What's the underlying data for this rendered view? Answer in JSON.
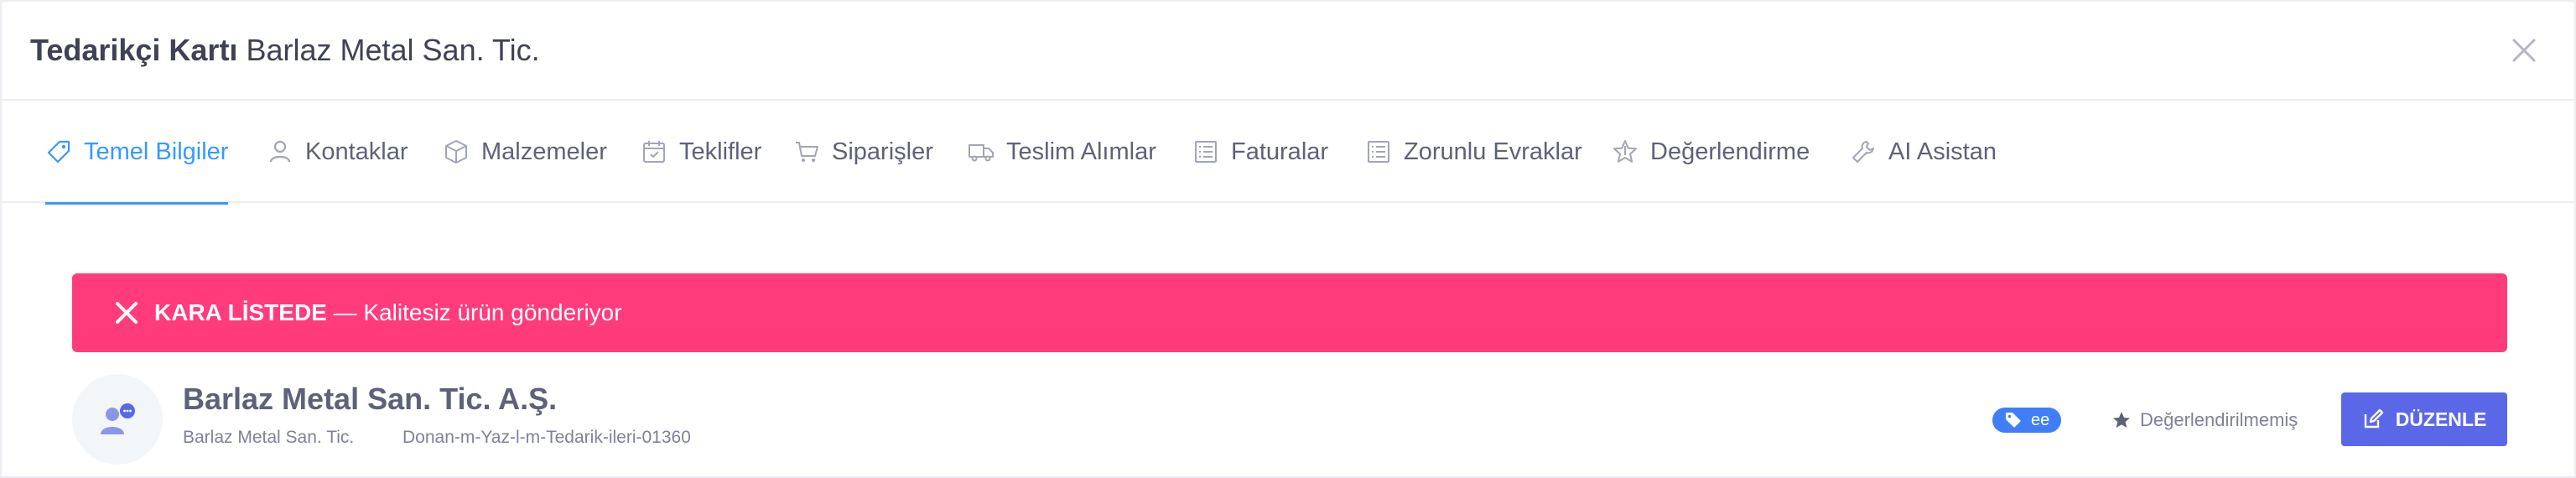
{
  "header": {
    "title_bold": "Tedarikçi Kartı",
    "title_rest": "Barlaz Metal San. Tic.",
    "close_icon": "close-icon"
  },
  "tabs": [
    {
      "label": "Temel Bilgiler",
      "icon": "tag-icon",
      "active": true
    },
    {
      "label": "Kontaklar",
      "icon": "user-icon",
      "active": false
    },
    {
      "label": "Malzemeler",
      "icon": "box-icon",
      "active": false
    },
    {
      "label": "Teklifler",
      "icon": "calendar-icon",
      "active": false
    },
    {
      "label": "Siparişler",
      "icon": "cart-icon",
      "active": false
    },
    {
      "label": "Teslim Alımlar",
      "icon": "truck-icon",
      "active": false
    },
    {
      "label": "Faturalar",
      "icon": "list-icon",
      "active": false
    },
    {
      "label": "Zorunlu Evraklar",
      "icon": "list-icon",
      "active": false
    },
    {
      "label": "Değerlendirme",
      "icon": "star-icon",
      "active": false
    },
    {
      "label": "AI Asistan",
      "icon": "tools-icon",
      "active": false
    }
  ],
  "alert": {
    "title": "KARA LİSTEDE",
    "message": " — Kalitesiz ürün gönderiyor",
    "color": "#ff3b7b"
  },
  "supplier": {
    "name": "Barlaz Metal San. Tic. A.Ş.",
    "short_name": "Barlaz Metal San. Tic.",
    "code": "Donan-m-Yaz-l-m-Tedarik-ileri-01360",
    "tag": "ee",
    "rating": "Değerlendirilmemiş",
    "edit_label": "DÜZENLE"
  },
  "colors": {
    "accent": "#3699ff",
    "button": "#5a68e8",
    "tag": "#3f7ef7"
  }
}
